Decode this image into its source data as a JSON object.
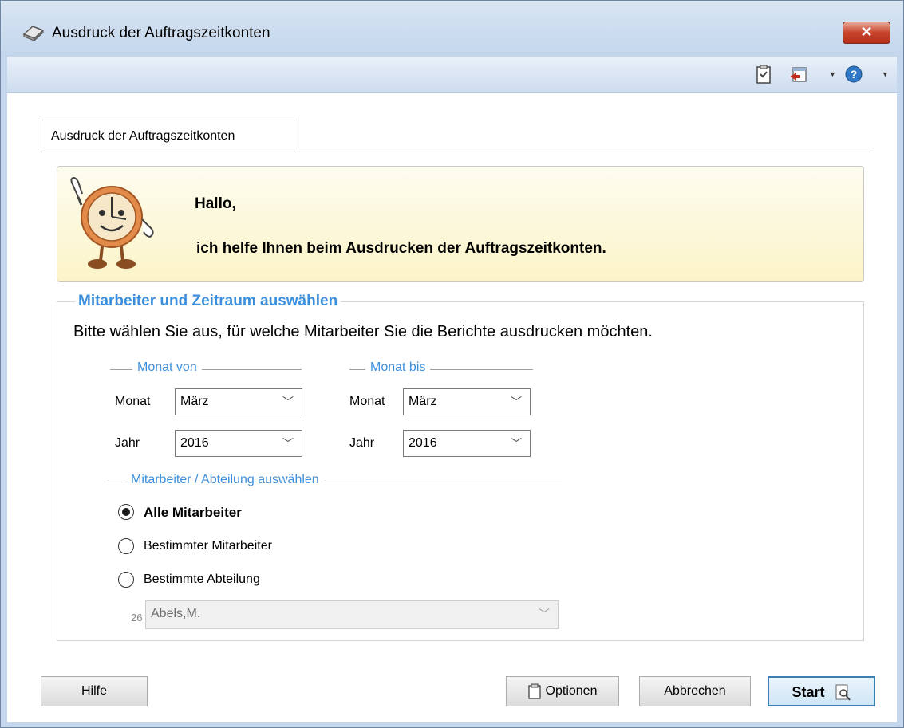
{
  "window": {
    "title": "Ausdruck der Auftragszeitkonten",
    "close_glyph": "✕"
  },
  "toolbar": {
    "icons": [
      "clipboard-icon",
      "exit-icon",
      "help-icon"
    ]
  },
  "tab": {
    "label": "Ausdruck der Auftragszeitkonten"
  },
  "banner": {
    "greeting": "Hallo,",
    "message": "ich helfe Ihnen beim Ausdrucken der Auftragszeitkonten."
  },
  "group": {
    "title": "Mitarbeiter und Zeitraum auswählen",
    "description": "Bitte wählen Sie aus, für welche Mitarbeiter Sie die Berichte ausdrucken möchten.",
    "from": {
      "title": "Monat von",
      "month_label": "Monat",
      "month_value": "März",
      "year_label": "Jahr",
      "year_value": "2016"
    },
    "to": {
      "title": "Monat bis",
      "month_label": "Monat",
      "month_value": "März",
      "year_label": "Jahr",
      "year_value": "2016"
    },
    "selection": {
      "title": "Mitarbeiter / Abteilung auswählen",
      "options": [
        "Alle Mitarbeiter",
        "Bestimmter Mitarbeiter",
        "Bestimmte Abteilung"
      ],
      "selected_index": 0,
      "employee_number": "26",
      "employee_value": "Abels,M."
    }
  },
  "buttons": {
    "help": "Hilfe",
    "options": "Optionen",
    "cancel": "Abbrechen",
    "start": "Start"
  },
  "colors": {
    "accent": "#3b8fdc",
    "banner_bg": "#fcf4c8",
    "close": "#c7432b"
  }
}
